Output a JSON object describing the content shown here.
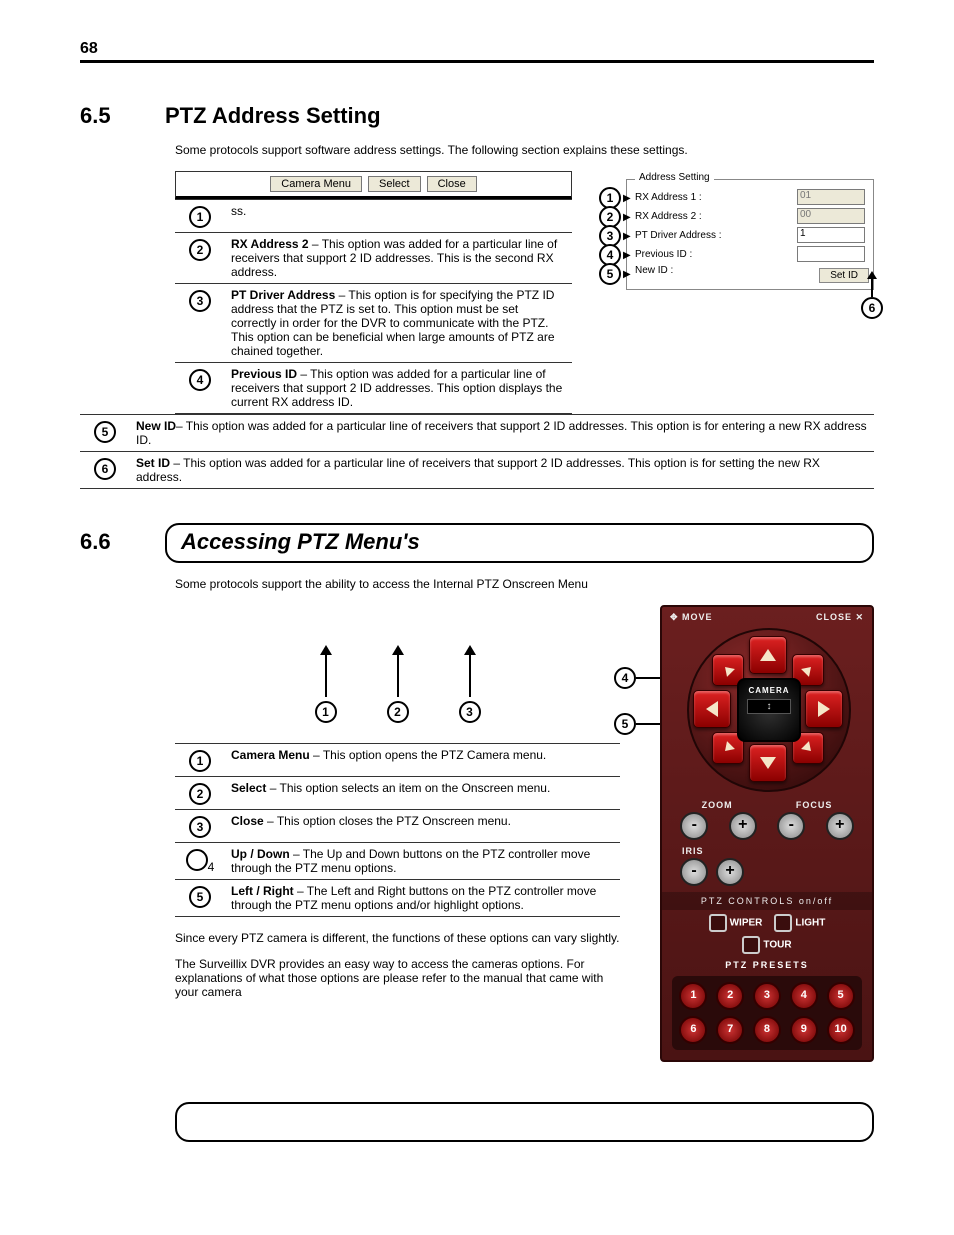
{
  "page_number": "68",
  "section65": {
    "num": "6.5",
    "title": "PTZ Address Setting",
    "intro": "Some protocols support software address settings.  The following section explains these settings.",
    "cam_buttons": [
      "Camera Menu",
      "Select",
      "Close"
    ],
    "rows": [
      {
        "n": "1",
        "title": "",
        "text": "ss."
      },
      {
        "n": "2",
        "title": "RX Address 2",
        "text": " – This option was added for a particular line of receivers that support 2 ID addresses. This is the second RX address."
      },
      {
        "n": "3",
        "title": "PT Driver Address",
        "text": " – This option is for specifying the PTZ ID address that the PTZ is set to. This option must be set correctly in order for the DVR to communicate with the PTZ. This option can be beneficial when large amounts of PTZ are chained together."
      },
      {
        "n": "4",
        "title": "Previous ID",
        "text": " – This option was added for a particular line of receivers that support 2 ID addresses. This option displays the current RX address ID."
      },
      {
        "n": "5",
        "title": "New ID",
        "text": "– This option was added for a particular line of receivers that support 2 ID addresses. This option is for entering a new RX address ID."
      },
      {
        "n": "6",
        "title": "Set ID",
        "text": " – This option was added for a particular line of receivers that support 2 ID addresses. This option is for setting the new RX address."
      }
    ],
    "address_box": {
      "legend": "Address Setting",
      "rx1_label": "RX Address 1 :",
      "rx1_value": "01",
      "rx2_label": "RX Address 2 :",
      "rx2_value": "00",
      "pt_label": "PT Driver Address :",
      "pt_value": "1",
      "prev_label": "Previous ID :",
      "new_label": "New ID :",
      "setid": "Set ID"
    }
  },
  "section66": {
    "num": "6.6",
    "title": "Accessing PTZ Menu's",
    "intro": "Some protocols support the ability to access the Internal PTZ Onscreen Menu",
    "arrow_labels": [
      "1",
      "2",
      "3"
    ],
    "rows": [
      {
        "n": "1",
        "title": "Camera Menu",
        "text": " – This option opens the PTZ Camera menu."
      },
      {
        "n": "2",
        "title": "Select",
        "text": " – This option selects an item on the Onscreen menu."
      },
      {
        "n": "3",
        "title": "Close",
        "text": " – This option closes the PTZ Onscreen menu."
      },
      {
        "n": "4",
        "title": "Up / Down",
        "text": " – The Up and Down buttons on the PTZ controller move through the PTZ menu options."
      },
      {
        "n": "5",
        "title": "Left / Right",
        "text": " – The Left and Right buttons on the PTZ controller move through the PTZ menu options and/or highlight options."
      }
    ],
    "p1": "Since every PTZ camera is different, the functions of these options can vary slightly.",
    "p2": "The Surveillix  DVR provides an easy way to access the cameras options. For explanations of what those options are please refer to the manual that came with your camera"
  },
  "ptz": {
    "move": "✥ MOVE",
    "close": "CLOSE ✕",
    "camera": "CAMERA",
    "camera_disp": "↕",
    "zoom": "ZOOM",
    "focus": "FOCUS",
    "iris": "IRIS",
    "controls": "PTZ CONTROLS  on/off",
    "wiper": "WIPER",
    "light": "LIGHT",
    "tour": "TOUR",
    "presets_label": "PTZ PRESETS",
    "presets": [
      "1",
      "2",
      "3",
      "4",
      "5",
      "6",
      "7",
      "8",
      "9",
      "10"
    ]
  }
}
